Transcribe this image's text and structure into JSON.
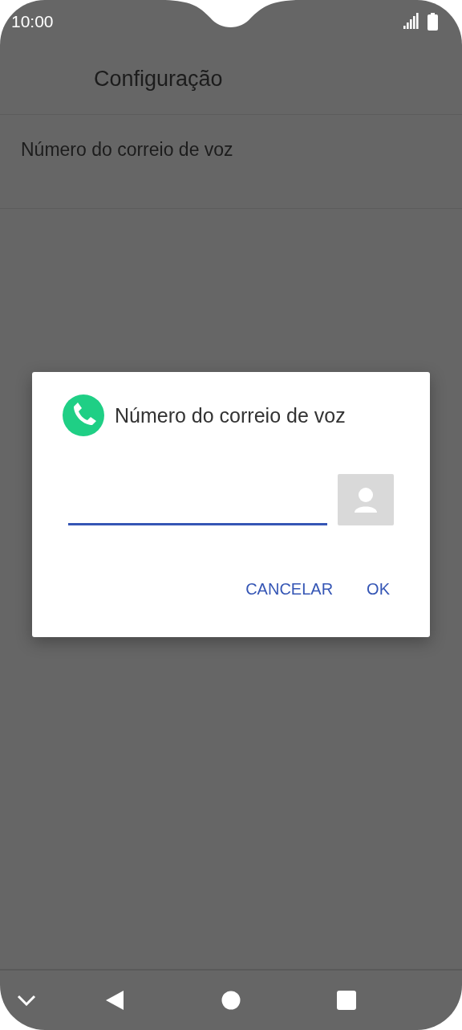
{
  "status_bar": {
    "time": "10:00"
  },
  "app_bar": {
    "title": "Configuração"
  },
  "settings": [
    {
      "label": "Número do correio de voz"
    }
  ],
  "dialog": {
    "title": "Número do correio de voz",
    "buttons": [
      {
        "label": "CANCELAR"
      },
      {
        "label": "OK"
      }
    ]
  }
}
